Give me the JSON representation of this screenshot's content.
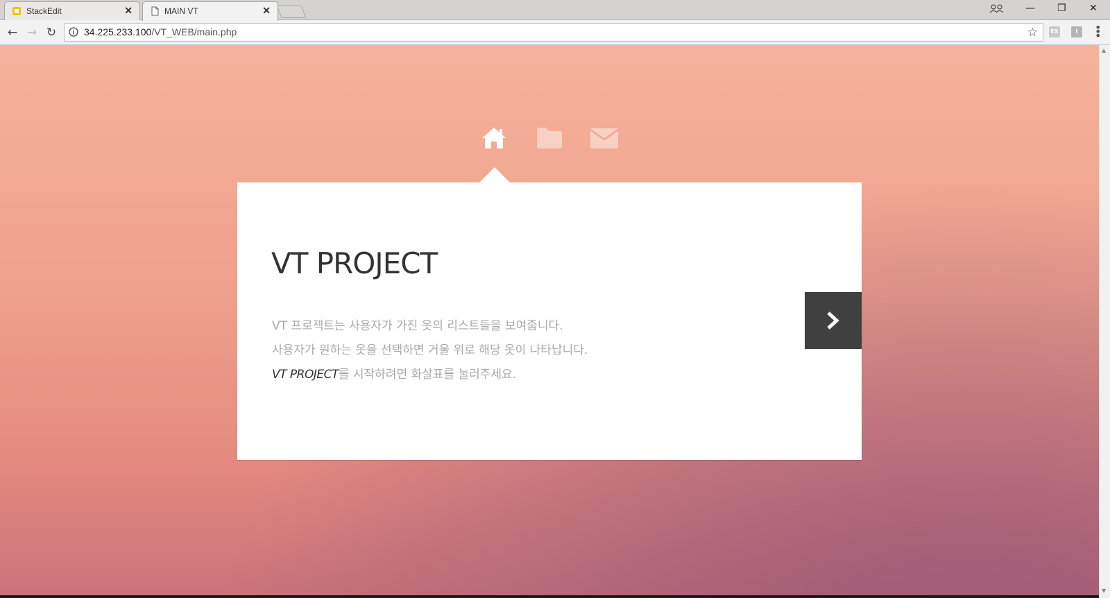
{
  "browser": {
    "tabs": [
      {
        "title": "StackEdit",
        "favicon": "stackedit-icon",
        "active": false
      },
      {
        "title": "MAIN VT",
        "favicon": "page-icon",
        "active": true
      }
    ],
    "close_glyph": "✕",
    "address": {
      "host": "34.225.233.100",
      "path": "/VT_WEB/main.php"
    },
    "buttons": {
      "back": "←",
      "forward": "→",
      "reload": "↻",
      "star": "☆"
    },
    "window_controls": {
      "minimize": "—",
      "maximize": "❐",
      "close": "✕"
    },
    "extension_label": "EX",
    "extension2_label": "I"
  },
  "page": {
    "nav": [
      "home-icon",
      "folder-icon",
      "mail-icon"
    ],
    "card": {
      "title": "VT PROJECT",
      "line1": "VT 프로젝트는 사용자가 가진 옷의 리스트들을 보여줍니다.",
      "line2": "사용자가 원하는 옷을 선택하면 거울 위로 해당 옷이 나타납니다.",
      "line3_em": "VT PROJECT",
      "line3_rest": "를 시작하려면 화살표를 눌러주세요."
    },
    "next_button": "chevron-right-icon"
  },
  "colors": {
    "bg_top": "#f6b29b",
    "bg_bottom": "#c97379",
    "button": "#404040"
  }
}
